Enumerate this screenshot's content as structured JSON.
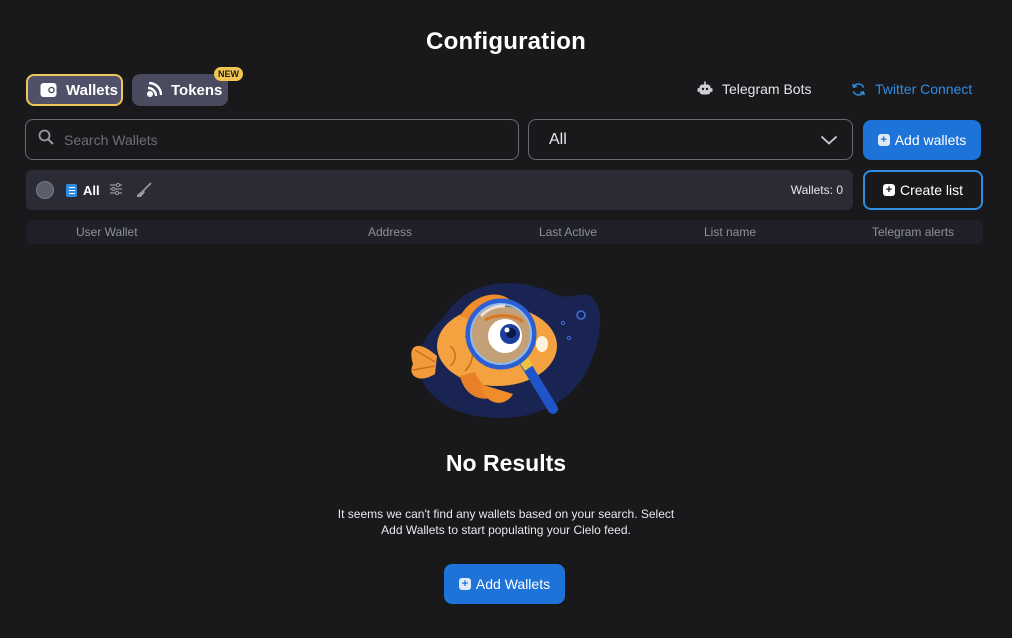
{
  "page": {
    "title": "Configuration"
  },
  "tabs": [
    {
      "label": "Wallets",
      "icon": "wallet-icon",
      "active": true
    },
    {
      "label": "Tokens",
      "icon": "tokens-icon",
      "badge": "NEW"
    }
  ],
  "header_links": {
    "telegram": {
      "label": "Telegram Bots",
      "icon": "robot-icon"
    },
    "twitter": {
      "label": "Twitter Connect",
      "icon": "refresh-icon"
    }
  },
  "search": {
    "placeholder": "Search Wallets",
    "value": ""
  },
  "filter_select": {
    "value": "All"
  },
  "add_wallets_button": {
    "label": "Add wallets"
  },
  "filter_bar": {
    "all_label": "All",
    "wallets_count": "Wallets: 0"
  },
  "create_list_button": {
    "label": "Create list"
  },
  "table": {
    "columns": [
      "User Wallet",
      "Address",
      "Last Active",
      "List name",
      "Telegram alerts"
    ]
  },
  "empty_state": {
    "title": "No Results",
    "line1": "It seems we can't find any wallets based on your search. Select",
    "line2": "Add Wallets to start populating your Cielo feed.",
    "button_label": "Add Wallets",
    "illustration": "goldfish-magnifier"
  },
  "colors": {
    "background": "#19191b",
    "accent_blue": "#1d73d8",
    "link_blue": "#2e8de0",
    "active_tab_border": "#efc65a",
    "badge_new": "#f0c552"
  }
}
